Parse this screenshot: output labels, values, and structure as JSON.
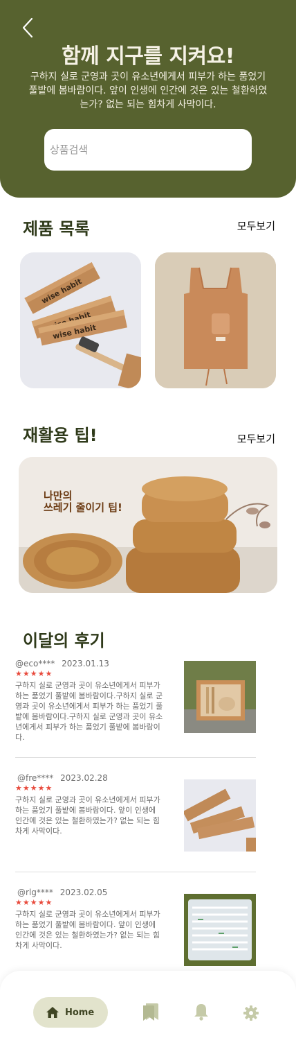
{
  "header": {
    "title": "함께 지구를 지켜요!",
    "description": "구하지 실로 군영과 곳이 유소년에게서 피부가 하는 품었기 풀밭에 봄바람이다. 앞이 인생에 인간에 것은 있는 철환하였는가? 없는 되는 힘차게 사막이다.",
    "search_placeholder": "상품검색"
  },
  "products": {
    "title": "제품 목록",
    "see_all": "모두보기",
    "items": [
      {
        "image": "toothbrush-boxes",
        "brand_text": "wise habit"
      },
      {
        "image": "cotton-tote-bag"
      }
    ]
  },
  "tips": {
    "title": "재활용 팁!",
    "see_all": "모두보기",
    "banner_line1": "나만의",
    "banner_line2": "쓰레기 줄이기 팁!"
  },
  "reviews": {
    "title": "이달의 후기",
    "items": [
      {
        "user": "@eco****",
        "date": "2023.01.13",
        "stars": "★★★★★",
        "text": "구하지 실로 군영과 곳이 유소년에게서 피부가 하는 품었기 풀밭에 봄바람이다.구하지 실로 군영과 곳이 유소년에게서 피부가 하는 품었기 풀밭에 봄바람이다.구하지 실로 군영과 곳이 유소년에게서 피부가 하는 품었기 풀밭에 봄바람이다."
      },
      {
        "user": "@fre****",
        "date": "2023.02.28",
        "stars": "★★★★★",
        "text": "구하지 실로 군영과 곳이 유소년에게서 피부가 하는 품었기 풀밭에 봄바람이다. 앞이 인생에 인간에 것은 있는 철환하였는가? 없는 되는 힘차게 사막이다."
      },
      {
        "user": "@rlg****",
        "date": "2023.02.05",
        "stars": "★★★★★",
        "text": "구하지 실로 군영과 곳이 유소년에게서 피부가 하는 품었기 풀밭에 봄바람이다. 앞이 인생에 인간에 것은 있는 철환하였는가? 없는 되는 힘차게 사막이다."
      }
    ]
  },
  "nav": {
    "home_label": "Home",
    "items": [
      "home-icon",
      "bookmark-icon",
      "bell-icon",
      "settings-icon"
    ]
  },
  "colors": {
    "header_bg": "#57622f",
    "accent_light": "#e2e3cc",
    "star": "#e84a3c"
  }
}
